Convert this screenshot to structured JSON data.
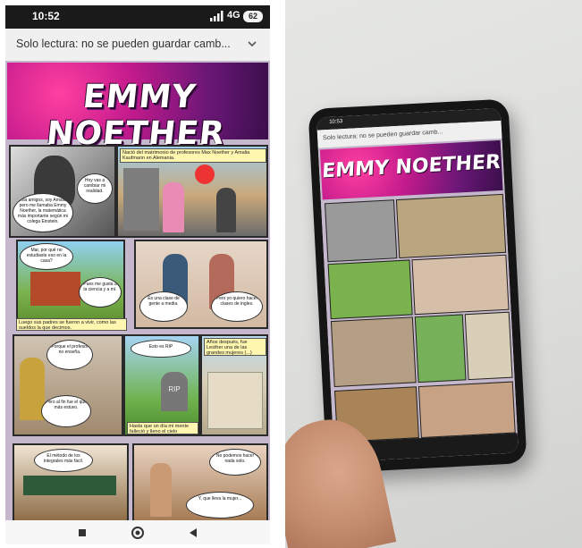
{
  "left_screen": {
    "status_bar": {
      "time": "10:52",
      "network": "4G",
      "battery": "62"
    },
    "readonly_bar": {
      "text": "Solo lectura: no se pueden guardar camb...",
      "chevron_icon": "chevron-down-icon"
    },
    "comic": {
      "title": "EMMY NOETHER",
      "captions": [
        "Nació del matrimonio de profesores Max Noether y Amalia Kaufmann en Alemania.",
        "Luego sus padres se fueron a vivir, como las sueldos la que decimos.",
        "Años después, fue Lesther una de las grandes mujeres (...)",
        "Hasta que un día mi mente falleció y lleno el cielo entristecido."
      ],
      "bubbles": [
        "Hola amigos, soy Amalia, pero me llamaba Emmy Noether, la matemática más importante según mi colega Einstein.",
        "Hoy vas a cambiar mi realidad.",
        "Mar, por qué no estudiaste eso en la casa?",
        "Pues me gusta a la ciencia y a mí.",
        "Es una clase de gente a media.",
        "Pero yo quiero hacer clases de ingles.",
        "Porque el profesor no enseña.",
        "Pero al fin fue el que más estuvo.",
        "Esto es RIP",
        "El método de los integrales más fácil.",
        "No podemos hacer nada solo.",
        "Y, que lleva la mujer..."
      ],
      "rip_text": "RIP"
    },
    "nav_bar": {
      "back_icon": "back-triangle-icon",
      "home_icon": "home-circle-icon",
      "recents_icon": "recents-square-icon"
    }
  },
  "right_photo": {
    "phone_status_time": "10:53",
    "phone_readonly_text": "Solo lectura: no se pueden guardar camb...",
    "phone_comic_title": "EMMY NOETHER"
  },
  "colors": {
    "comic_background": "#c5b7cc",
    "banner_pink": "#ff3fa0",
    "banner_purple": "#6a1777",
    "caption_yellow": "#fff6b0"
  }
}
